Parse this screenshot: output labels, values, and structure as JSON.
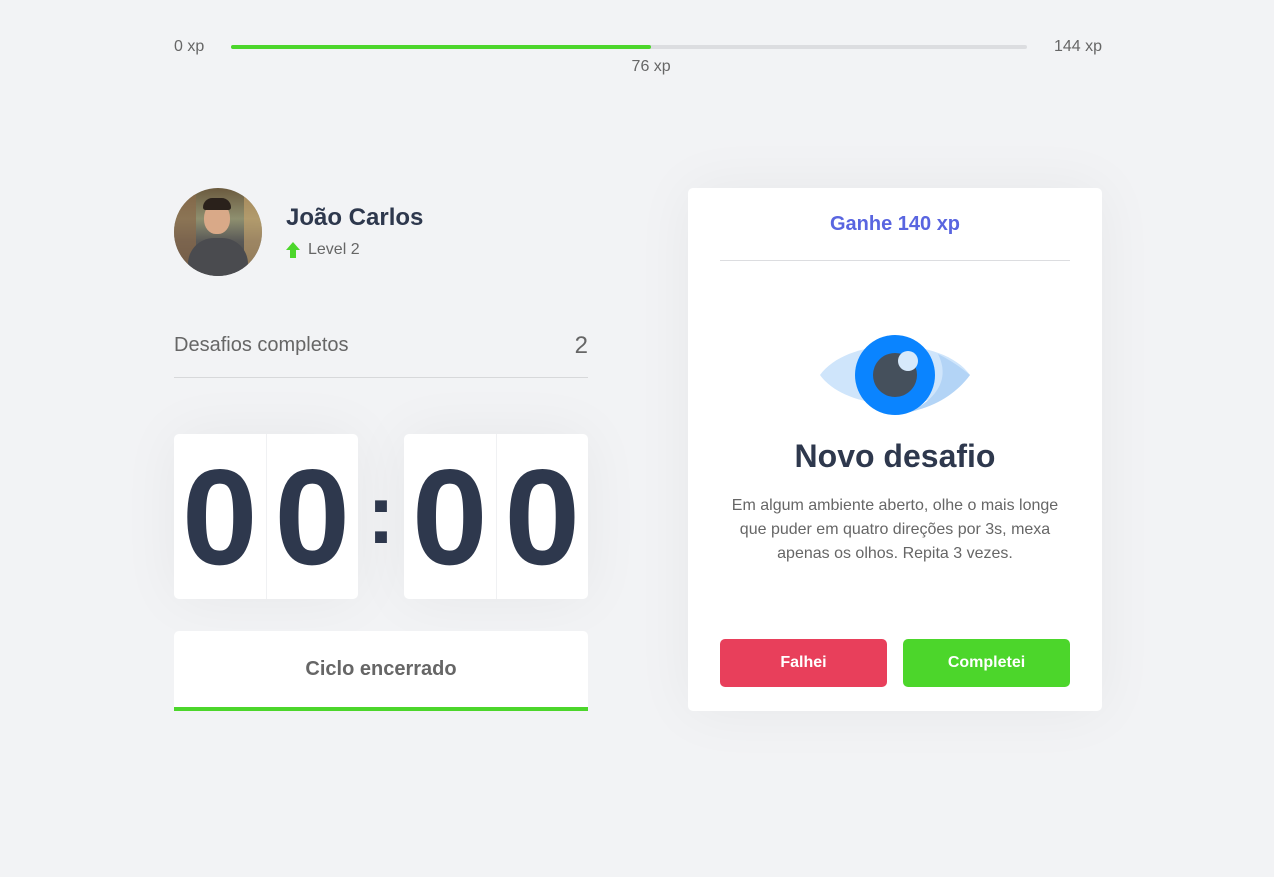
{
  "xp_bar": {
    "min_label": "0 xp",
    "max_label": "144 xp",
    "current_label": "76 xp",
    "progress_fraction": 0.5278,
    "fill_color": "#4cd62b",
    "track_color": "#dcdde0"
  },
  "profile": {
    "name": "João Carlos",
    "level_label": "Level 2",
    "level_icon": "arrow-up-icon"
  },
  "completed": {
    "label": "Desafios completos",
    "count": "2"
  },
  "countdown": {
    "minute_left": "0",
    "minute_right": "0",
    "separator": ":",
    "second_left": "0",
    "second_right": "0"
  },
  "cycle_button": {
    "label": "Ciclo encerrado"
  },
  "challenge": {
    "reward": "Ganhe 140 xp",
    "icon": "eye-icon",
    "title": "Novo desafio",
    "description": "Em algum ambiente aberto, olhe o mais longe que puder em quatro direções por 3s, mexa apenas os olhos. Repita 3 vezes.",
    "fail_label": "Falhei",
    "success_label": "Completei"
  },
  "colors": {
    "background": "#f2f3f5",
    "title": "#2e384d",
    "text": "#666666",
    "blue": "#5965e0",
    "green": "#4cd62b",
    "red": "#e83f5b"
  }
}
